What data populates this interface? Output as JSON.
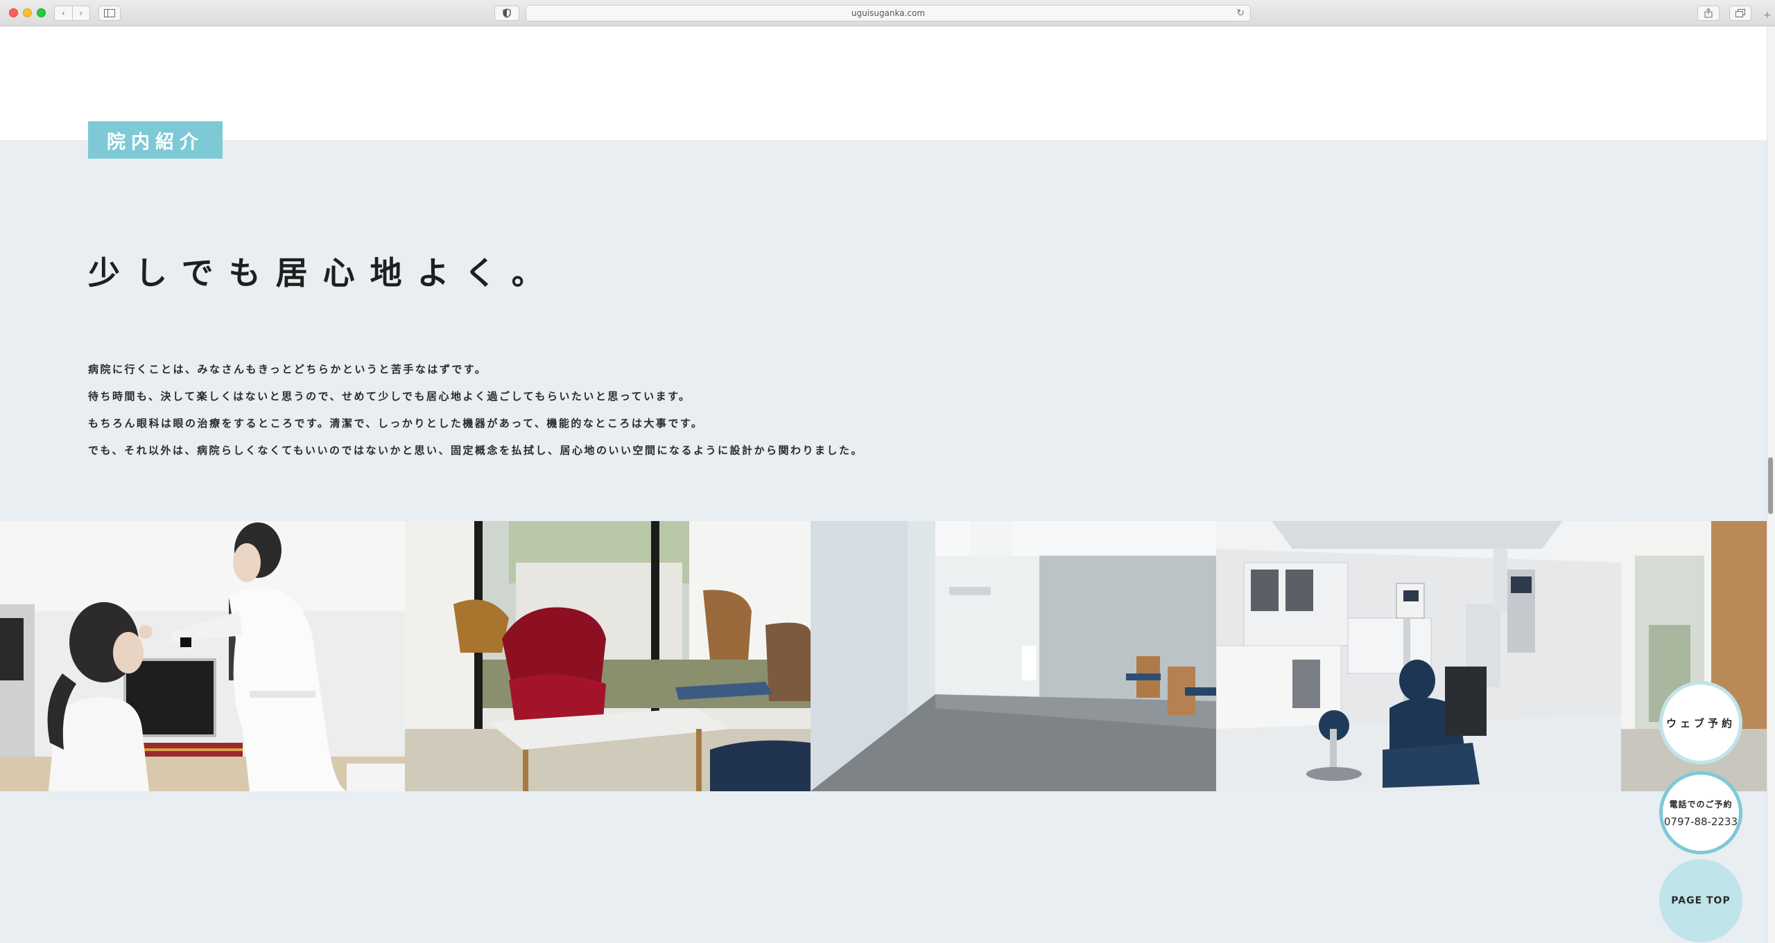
{
  "browser": {
    "url": "uguisuganka.com",
    "nav_back_icon": "chevron-left-icon",
    "nav_forward_icon": "chevron-right-icon",
    "sidebar_icon": "sidebar-icon",
    "privacy_icon": "shield-icon",
    "reload_icon": "reload-icon",
    "share_icon": "share-icon",
    "tabs_icon": "tabs-icon",
    "new_tab_icon": "plus-icon"
  },
  "section": {
    "label": "院内紹介",
    "headline": "少しでも居心地よく。",
    "body": [
      "病院に行くことは、みなさんもきっとどちらかというと苦手なはずです。",
      "待ち時間も、決して楽しくはないと思うので、せめて少しでも居心地よく過ごしてもらいたいと思っています。",
      "もちろん眼科は眼の治療をするところです。清潔で、しっかりとした機器があって、機能的なところは大事です。",
      "でも、それ以外は、病院らしくなくてもいいのではないかと思い、固定概念を払拭し、居心地のいい空間になるように設計から関わりました。"
    ]
  },
  "gallery": {
    "photos": [
      "staff-examination-photo",
      "waiting-area-red-chair-photo",
      "hallway-photo",
      "treatment-room-photo",
      "window-room-photo"
    ]
  },
  "floating": {
    "web_reserve": "ウェブ予約",
    "phone_label": "電話でのご予約",
    "phone_number": "0797-88-2233",
    "page_top": "PAGE TOP"
  },
  "colors": {
    "accent": "#7ec9d6",
    "accent_light": "#bfe4ea",
    "section_bg": "#e8eef1"
  }
}
